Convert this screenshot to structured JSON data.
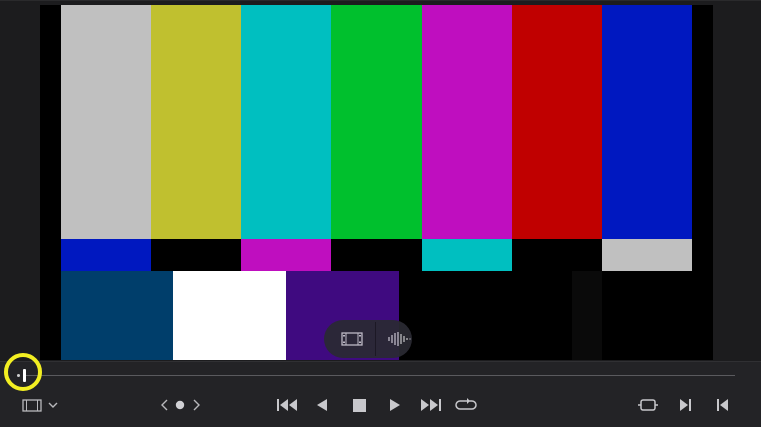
{
  "viewer": {
    "test_pattern": "color-bars",
    "colors": {
      "gray": "#c0c0c0",
      "yellow": "#c0c02f",
      "cyan": "#00bfc0",
      "green": "#00c02d",
      "magenta": "#bf0ebf",
      "red": "#c00000",
      "blue": "#0018c0",
      "black": "#000000",
      "navy": "#003e6b",
      "white": "#ffffff",
      "purple": "#3f0a80",
      "darkstrip": "#0a0a0a"
    },
    "overlay": {
      "left_icon": "filmstrip-icon",
      "right_icon": "audio-waveform-icon"
    }
  },
  "transport": {
    "view_menu_icon": "filmstrip-icon",
    "nav_prev_icon": "chevron-left-icon",
    "nav_marker_icon": "dot-icon",
    "nav_next_icon": "chevron-right-icon",
    "buttons": [
      "skip-to-start-icon",
      "step-back-icon",
      "stop-icon",
      "play-icon",
      "skip-to-end-icon",
      "loop-icon"
    ],
    "right_buttons": [
      "match-frame-icon",
      "next-clip-icon",
      "prev-clip-icon"
    ]
  },
  "accent": "#f3ef22"
}
